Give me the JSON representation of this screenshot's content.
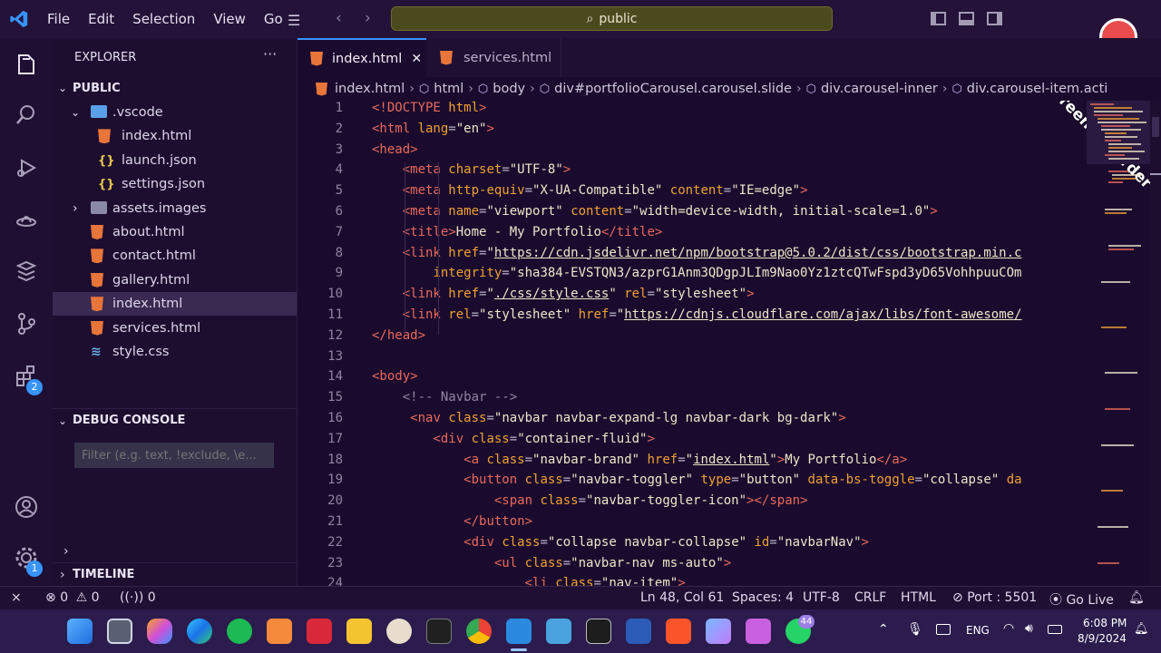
{
  "menu": [
    "File",
    "Edit",
    "Selection",
    "View",
    "Go"
  ],
  "search": {
    "text": "public"
  },
  "watermark": {
    "text": "iTop Screen Recorder"
  },
  "explorer": {
    "header": "EXPLORER",
    "root": "PUBLIC",
    "items": [
      {
        "label": ".vscode",
        "kind": "folder-open",
        "indent": 1
      },
      {
        "label": "index.html",
        "kind": "html",
        "indent": 2
      },
      {
        "label": "launch.json",
        "kind": "json",
        "indent": 2
      },
      {
        "label": "settings.json",
        "kind": "json",
        "indent": 2
      },
      {
        "label": "assets.images",
        "kind": "folder",
        "indent": 1
      },
      {
        "label": "about.html",
        "kind": "html",
        "indent": 1
      },
      {
        "label": "contact.html",
        "kind": "html",
        "indent": 1
      },
      {
        "label": "gallery.html",
        "kind": "html",
        "indent": 1
      },
      {
        "label": "index.html",
        "kind": "html",
        "indent": 1
      },
      {
        "label": "services.html",
        "kind": "html",
        "indent": 1
      },
      {
        "label": "style.css",
        "kind": "css",
        "indent": 1
      }
    ],
    "debug_header": "DEBUG CONSOLE",
    "filter_placeholder": "Filter (e.g. text, !exclude, \\e...",
    "timeline": "TIMELINE"
  },
  "activity_badges": {
    "extensions": "2",
    "settings": "1"
  },
  "tabs": [
    {
      "label": "index.html",
      "active": true
    },
    {
      "label": "services.html",
      "active": false
    }
  ],
  "breadcrumb": [
    "index.html",
    "html",
    "body",
    "div#portfolioCarousel.carousel.slide",
    "div.carousel-inner",
    "div.carousel-item.acti"
  ],
  "code": [
    [
      [
        "t",
        "<!DOCTYPE "
      ],
      [
        "a",
        "html"
      ],
      [
        "t",
        ">"
      ]
    ],
    [
      [
        "t",
        "<html "
      ],
      [
        "a",
        "lang"
      ],
      [
        "p",
        "="
      ],
      [
        "s",
        "\"en\""
      ],
      [
        "t",
        ">"
      ]
    ],
    [
      [
        "t",
        "<head>"
      ]
    ],
    [
      [
        "p",
        "    "
      ],
      [
        "t",
        "<meta "
      ],
      [
        "a",
        "charset"
      ],
      [
        "p",
        "="
      ],
      [
        "s",
        "\"UTF-8\""
      ],
      [
        "t",
        ">"
      ]
    ],
    [
      [
        "p",
        "    "
      ],
      [
        "t",
        "<meta "
      ],
      [
        "a",
        "http-equiv"
      ],
      [
        "p",
        "="
      ],
      [
        "s",
        "\"X-UA-Compatible\""
      ],
      [
        "p",
        " "
      ],
      [
        "a",
        "content"
      ],
      [
        "p",
        "="
      ],
      [
        "s",
        "\"IE=edge\""
      ],
      [
        "t",
        ">"
      ]
    ],
    [
      [
        "p",
        "    "
      ],
      [
        "t",
        "<meta "
      ],
      [
        "a",
        "name"
      ],
      [
        "p",
        "="
      ],
      [
        "s",
        "\"viewport\""
      ],
      [
        "p",
        " "
      ],
      [
        "a",
        "content"
      ],
      [
        "p",
        "="
      ],
      [
        "s",
        "\"width=device-width, initial-scale=1.0\""
      ],
      [
        "t",
        ">"
      ]
    ],
    [
      [
        "p",
        "    "
      ],
      [
        "t",
        "<title>"
      ],
      [
        "s",
        "Home - My Portfolio"
      ],
      [
        "t",
        "</title>"
      ]
    ],
    [
      [
        "p",
        "    "
      ],
      [
        "t",
        "<link "
      ],
      [
        "a",
        "href"
      ],
      [
        "p",
        "="
      ],
      [
        "s",
        "\""
      ],
      [
        "u",
        "https://cdn.jsdelivr.net/npm/bootstrap@5.0.2/dist/css/bootstrap.min.c"
      ]
    ],
    [
      [
        "p",
        "        "
      ],
      [
        "a",
        "integrity"
      ],
      [
        "p",
        "="
      ],
      [
        "s",
        "\"sha384-EVSTQN3/azprG1Anm3QDgpJLIm9Nao0Yz1ztcQTwFspd3yD65VohhpuuCOm"
      ]
    ],
    [
      [
        "p",
        "    "
      ],
      [
        "t",
        "<link "
      ],
      [
        "a",
        "href"
      ],
      [
        "p",
        "="
      ],
      [
        "s",
        "\""
      ],
      [
        "u",
        "./css/style.css"
      ],
      [
        "s",
        "\""
      ],
      [
        "p",
        " "
      ],
      [
        "a",
        "rel"
      ],
      [
        "p",
        "="
      ],
      [
        "s",
        "\"stylesheet\""
      ],
      [
        "t",
        ">"
      ]
    ],
    [
      [
        "p",
        "    "
      ],
      [
        "t",
        "<link "
      ],
      [
        "a",
        "rel"
      ],
      [
        "p",
        "="
      ],
      [
        "s",
        "\"stylesheet\""
      ],
      [
        "p",
        " "
      ],
      [
        "a",
        "href"
      ],
      [
        "p",
        "="
      ],
      [
        "s",
        "\""
      ],
      [
        "u",
        "https://cdnjs.cloudflare.com/ajax/libs/font-awesome/"
      ]
    ],
    [
      [
        "t",
        "</head>"
      ]
    ],
    [],
    [
      [
        "t",
        "<body>"
      ]
    ],
    [
      [
        "p",
        "    "
      ],
      [
        "c",
        "<!-- Navbar -->"
      ]
    ],
    [
      [
        "p",
        "     "
      ],
      [
        "t",
        "<nav "
      ],
      [
        "a",
        "class"
      ],
      [
        "p",
        "="
      ],
      [
        "s",
        "\"navbar navbar-expand-lg navbar-dark bg-dark\""
      ],
      [
        "t",
        ">"
      ]
    ],
    [
      [
        "p",
        "        "
      ],
      [
        "t",
        "<div "
      ],
      [
        "a",
        "class"
      ],
      [
        "p",
        "="
      ],
      [
        "s",
        "\"container-fluid\""
      ],
      [
        "t",
        ">"
      ]
    ],
    [
      [
        "p",
        "            "
      ],
      [
        "t",
        "<a "
      ],
      [
        "a",
        "class"
      ],
      [
        "p",
        "="
      ],
      [
        "s",
        "\"navbar-brand\""
      ],
      [
        "p",
        " "
      ],
      [
        "a",
        "href"
      ],
      [
        "p",
        "="
      ],
      [
        "s",
        "\""
      ],
      [
        "u",
        "index.html"
      ],
      [
        "s",
        "\""
      ],
      [
        "t",
        ">"
      ],
      [
        "s",
        "My Portfolio"
      ],
      [
        "t",
        "</a>"
      ]
    ],
    [
      [
        "p",
        "            "
      ],
      [
        "t",
        "<button "
      ],
      [
        "a",
        "class"
      ],
      [
        "p",
        "="
      ],
      [
        "s",
        "\"navbar-toggler\""
      ],
      [
        "p",
        " "
      ],
      [
        "a",
        "type"
      ],
      [
        "p",
        "="
      ],
      [
        "s",
        "\"button\""
      ],
      [
        "p",
        " "
      ],
      [
        "a",
        "data-bs-toggle"
      ],
      [
        "p",
        "="
      ],
      [
        "s",
        "\"collapse\""
      ],
      [
        "p",
        " "
      ],
      [
        "a",
        "da"
      ]
    ],
    [
      [
        "p",
        "                "
      ],
      [
        "t",
        "<span "
      ],
      [
        "a",
        "class"
      ],
      [
        "p",
        "="
      ],
      [
        "s",
        "\"navbar-toggler-icon\""
      ],
      [
        "t",
        "></span>"
      ]
    ],
    [
      [
        "p",
        "            "
      ],
      [
        "t",
        "</button>"
      ]
    ],
    [
      [
        "p",
        "            "
      ],
      [
        "t",
        "<div "
      ],
      [
        "a",
        "class"
      ],
      [
        "p",
        "="
      ],
      [
        "s",
        "\"collapse navbar-collapse\""
      ],
      [
        "p",
        " "
      ],
      [
        "a",
        "id"
      ],
      [
        "p",
        "="
      ],
      [
        "s",
        "\"navbarNav\""
      ],
      [
        "t",
        ">"
      ]
    ],
    [
      [
        "p",
        "                "
      ],
      [
        "t",
        "<ul "
      ],
      [
        "a",
        "class"
      ],
      [
        "p",
        "="
      ],
      [
        "s",
        "\"navbar-nav ms-auto\""
      ],
      [
        "t",
        ">"
      ]
    ],
    [
      [
        "p",
        "                    "
      ],
      [
        "t",
        "<li "
      ],
      [
        "a",
        "class"
      ],
      [
        "p",
        "="
      ],
      [
        "s",
        "\"nav-item\""
      ],
      [
        "t",
        ">"
      ]
    ]
  ],
  "status": {
    "errors": "0",
    "warnings": "0",
    "ports": "0",
    "position": "Ln 48, Col 61",
    "spaces": "Spaces: 4",
    "encoding": "UTF-8",
    "eol": "CRLF",
    "language": "HTML",
    "port": "Port : 5501",
    "golive": "Go Live"
  },
  "taskbar": {
    "whatsapp_badge": "44",
    "lang": "ENG",
    "time": "6:08 PM",
    "date": "8/9/2024"
  },
  "colors": {
    "accent": "#3794ff",
    "title_bg": "#241238",
    "editor_bg": "#1a0b2e",
    "tag": "#e86a5a",
    "attr": "#f0a030",
    "string": "#efe6c8",
    "html_icon": "#e8763a"
  }
}
